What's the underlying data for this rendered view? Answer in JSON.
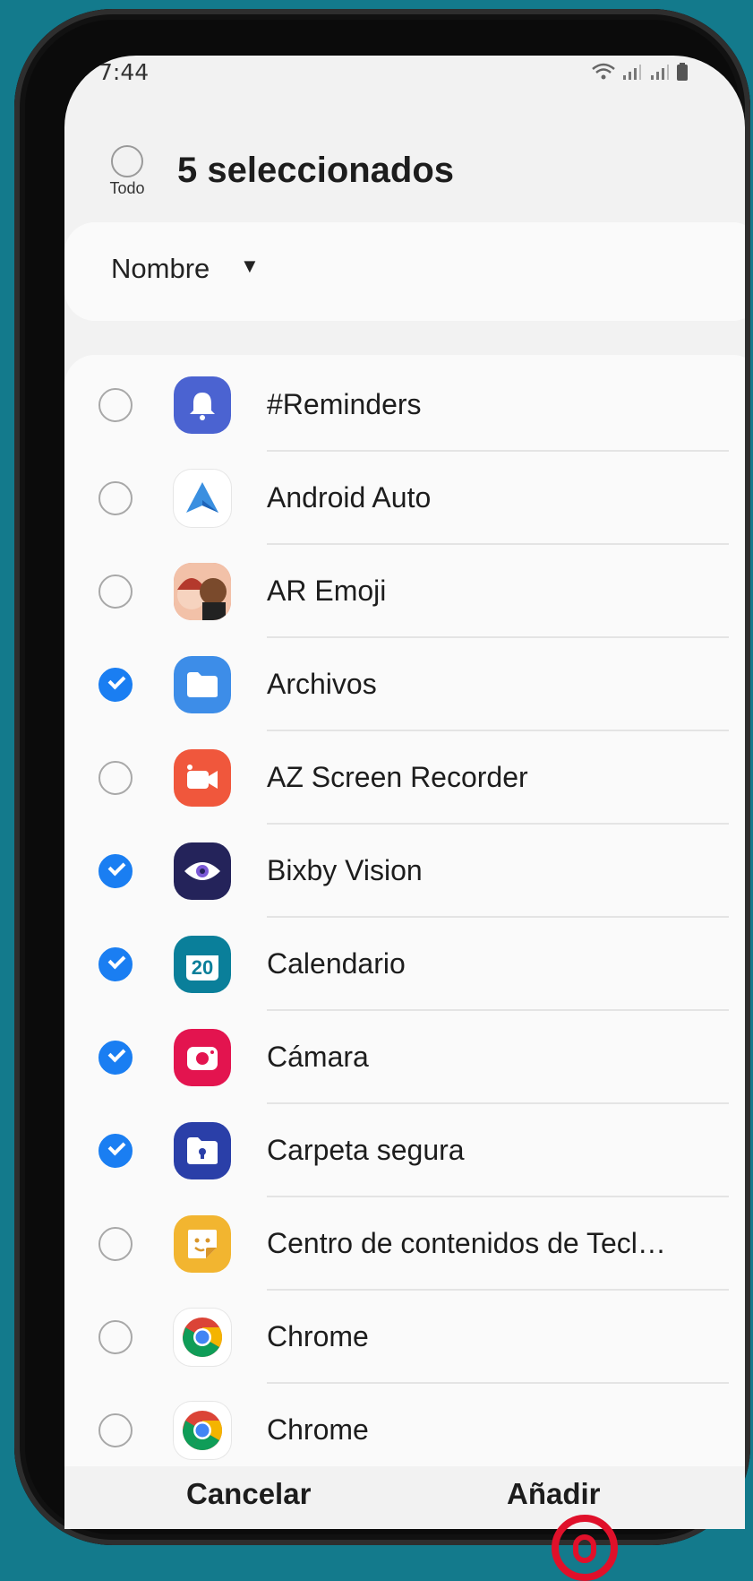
{
  "status": {
    "time": "7:44",
    "icons": "wifi-icon signal-icon signal-icon battery-icon"
  },
  "header": {
    "select_all_label": "Todo",
    "title": "5 seleccionados"
  },
  "sort": {
    "label": "Nombre"
  },
  "apps": [
    {
      "name": "#Reminders",
      "checked": false,
      "icon": "bell-icon",
      "color": "#4b63d1"
    },
    {
      "name": "Android Auto",
      "checked": false,
      "icon": "android-auto-icon",
      "color": "#ffffff"
    },
    {
      "name": "AR Emoji",
      "checked": false,
      "icon": "ar-emoji-icon",
      "color": "#e9775f"
    },
    {
      "name": "Archivos",
      "checked": true,
      "icon": "folder-icon",
      "color": "#3d8de8"
    },
    {
      "name": "AZ Screen Recorder",
      "checked": false,
      "icon": "video-camera-icon",
      "color": "#f0573c"
    },
    {
      "name": "Bixby Vision",
      "checked": true,
      "icon": "eye-icon",
      "color": "#24235a"
    },
    {
      "name": "Calendario",
      "checked": true,
      "icon": "calendar-icon",
      "color": "#0a7f9a",
      "badge": "20"
    },
    {
      "name": "Cámara",
      "checked": true,
      "icon": "camera-icon",
      "color": "#e3144f"
    },
    {
      "name": "Carpeta segura",
      "checked": true,
      "icon": "secure-folder-icon",
      "color": "#2a3fa8"
    },
    {
      "name": "Centro de contenidos de Tecl…",
      "checked": false,
      "icon": "sticker-icon",
      "color": "#f2b530"
    },
    {
      "name": "Chrome",
      "checked": false,
      "icon": "chrome-icon",
      "color": "#ffffff"
    },
    {
      "name": "Chrome",
      "checked": false,
      "icon": "chrome-icon",
      "color": "#ffffff"
    }
  ],
  "actions": {
    "cancel": "Cancelar",
    "add": "Añadir"
  }
}
